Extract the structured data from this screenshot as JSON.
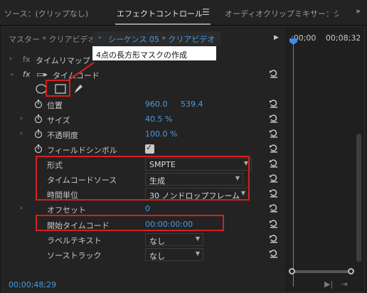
{
  "tabs": [
    {
      "label": "ソース：(クリップなし)",
      "active": false
    },
    {
      "label": "エフェクトコントロール",
      "active": true
    },
    {
      "label": "オーディオクリップミキサー：シー",
      "active": false
    }
  ],
  "panel_menu_icon": "hamburger-menu-icon",
  "overflow_icon": "double-chevron-right-icon",
  "header": {
    "master_label": "マスター * クリアビデオ",
    "sequence_label": "シーケンス 05 * クリアビデオ"
  },
  "timeline": {
    "time_start": ";00;00",
    "time_end": "00;08;32",
    "playhead_color": "#3a8fe8"
  },
  "effects": {
    "time_remap_label": "タイムリマップ",
    "timecode_label": "タイムコード"
  },
  "properties": [
    {
      "label": "位置",
      "value_x": "960.0",
      "value_y": "539.4"
    },
    {
      "label": "サイズ",
      "value": "40.5 %"
    },
    {
      "label": "不透明度",
      "value": "100.0 %"
    },
    {
      "label": "フィールドシンボル",
      "checked": true
    },
    {
      "label": "形式",
      "value": "SMPTE"
    },
    {
      "label": "タイムコードソース",
      "value": "生成"
    },
    {
      "label": "時間単位",
      "value": "30 ノンドロップフレーム"
    },
    {
      "label": "オフセット",
      "value": "0"
    },
    {
      "label": "開始タイムコード",
      "value": "00:00:00:00"
    },
    {
      "label": "ラベルテキスト",
      "value": "なし"
    },
    {
      "label": "ソーストラック",
      "value": "なし"
    }
  ],
  "annotation": {
    "callout_text": "4点の長方形マスクの作成",
    "highlight_color": "#d42020"
  },
  "footer": {
    "timecode": "00;00;48;29"
  },
  "colors": {
    "accent_blue": "#4a9be0",
    "panel_bg": "#232323"
  }
}
